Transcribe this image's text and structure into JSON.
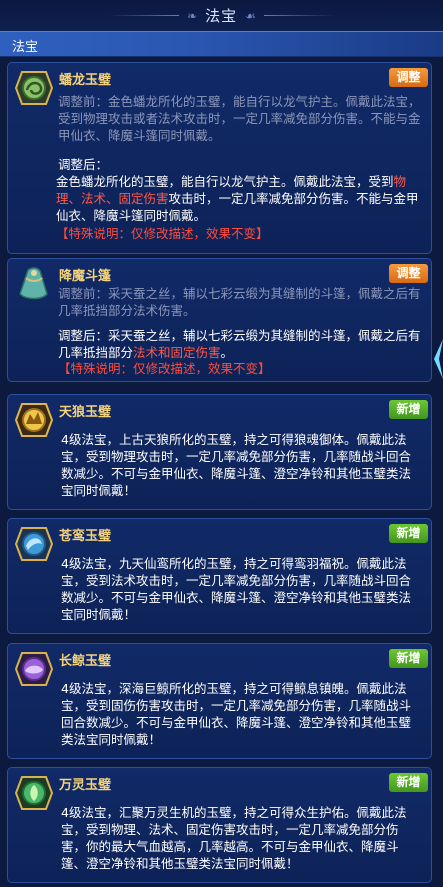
{
  "header": {
    "title": "法宝"
  },
  "section": {
    "label": "法宝"
  },
  "colors": {
    "highlight_red": "#ff5a4a",
    "badge_adjust": "#f0872a",
    "badge_new": "#5ab428",
    "title_gold": "#f3d27a"
  },
  "cards": [
    {
      "name": "蟠龙玉璧",
      "badge": "调整",
      "icon": "jade-disc-dragon-icon",
      "before_label": "调整前：",
      "before_text": "金色蟠龙所化的玉璧，能自行以龙气护主。佩戴此法宝，受到物理攻击或者法术攻击时，一定几率减免部分伤害。不能与金甲仙衣、降魔斗篷同时佩戴。",
      "after_label": "调整后：",
      "after_pre": "金色蟠龙所化的玉璧，能自行以龙气护主。佩戴此法宝，受到",
      "after_red": "物理、法术、固定伤害",
      "after_post": "攻击时，一定几率减免部分伤害。不能与金甲仙衣、降魔斗篷同时佩戴。",
      "note": "【特殊说明：仅修改描述，效果不变】"
    },
    {
      "name": "降魔斗篷",
      "badge": "调整",
      "icon": "cloak-icon",
      "before_label": "调整前：",
      "before_text": "采天蚕之丝，辅以七彩云缎为其缝制的斗篷，佩戴之后有几率抵挡部分法术伤害。",
      "after_label": "调整后：",
      "after_pre": "采天蚕之丝，辅以七彩云缎为其缝制的斗篷，佩戴之后有几率抵挡部分",
      "after_red": "法术和固定伤害",
      "after_post": "。",
      "note": "【特殊说明：仅修改描述，效果不变】"
    },
    {
      "name": "天狼玉璧",
      "badge": "新增",
      "icon": "jade-disc-wolf-icon",
      "text": "4级法宝，上古天狼所化的玉璧，持之可得狼魂御体。佩戴此法宝，受到物理攻击时，一定几率减免部分伤害，几率随战斗回合数减少。不可与金甲仙衣、降魔斗篷、澄空净铃和其他玉璧类法宝同时佩戴！"
    },
    {
      "name": "苍鸾玉璧",
      "badge": "新增",
      "icon": "jade-disc-phoenix-icon",
      "text": "4级法宝，九天仙鸾所化的玉璧，持之可得鸾羽福祝。佩戴此法宝，受到法术攻击时，一定几率减免部分伤害，几率随战斗回合数减少。不可与金甲仙衣、降魔斗篷、澄空净铃和其他玉璧类法宝同时佩戴！"
    },
    {
      "name": "长鲸玉璧",
      "badge": "新增",
      "icon": "jade-disc-whale-icon",
      "text": "4级法宝，深海巨鲸所化的玉璧，持之可得鲸息镇魄。佩戴此法宝，受到固伤伤害攻击时，一定几率减免部分伤害，几率随战斗回合数减少。不可与金甲仙衣、降魔斗篷、澄空净铃和其他玉璧类法宝同时佩戴！"
    },
    {
      "name": "万灵玉璧",
      "badge": "新增",
      "icon": "jade-disc-life-icon",
      "text": "4级法宝，汇聚万灵生机的玉璧，持之可得众生护佑。佩戴此法宝，受到物理、法术、固定伤害攻击时，一定几率减免部分伤害，你的最大气血越高，几率越高。不可与金甲仙衣、降魔斗篷、澄空净铃和其他玉璧类法宝同时佩戴！"
    }
  ]
}
